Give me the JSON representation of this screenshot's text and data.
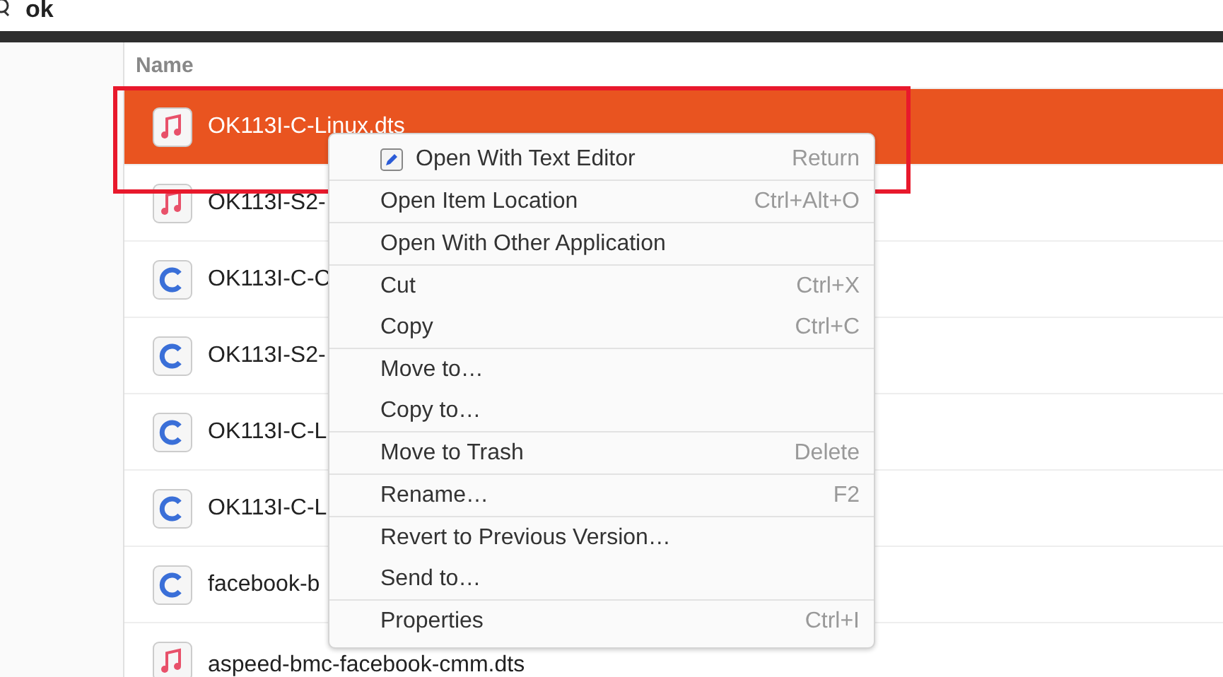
{
  "search": {
    "value": "ok"
  },
  "list": {
    "column_header": "Name",
    "rows": [
      {
        "name": "OK113I-C-Linux.dts",
        "kind": "music",
        "selected": true
      },
      {
        "name": "OK113I-S2-",
        "kind": "music",
        "selected": false
      },
      {
        "name": "OK113I-C-C",
        "kind": "c",
        "selected": false
      },
      {
        "name": "OK113I-S2-",
        "kind": "c",
        "selected": false
      },
      {
        "name": "OK113I-C-L",
        "kind": "c",
        "selected": false
      },
      {
        "name": "OK113I-C-L",
        "kind": "c",
        "selected": false
      },
      {
        "name": "facebook-b",
        "kind": "c",
        "selected": false
      },
      {
        "name": "aspeed-bmc-facebook-cmm.dts",
        "kind": "music",
        "selected": false
      }
    ]
  },
  "context_menu": {
    "groups": [
      [
        {
          "label": "Open With Text Editor",
          "shortcut": "Return",
          "kind": "editor"
        }
      ],
      [
        {
          "label": "Open Item Location",
          "shortcut": "Ctrl+Alt+O",
          "kind": "plain"
        }
      ],
      [
        {
          "label": "Open With Other Application",
          "kind": "plain"
        }
      ],
      [
        {
          "label": "Cut",
          "shortcut": "Ctrl+X",
          "kind": "plain"
        },
        {
          "label": "Copy",
          "shortcut": "Ctrl+C",
          "kind": "plain"
        }
      ],
      [
        {
          "label": "Move to…",
          "kind": "plain"
        },
        {
          "label": "Copy to…",
          "kind": "plain"
        }
      ],
      [
        {
          "label": "Move to Trash",
          "shortcut": "Delete",
          "kind": "plain"
        }
      ],
      [
        {
          "label": "Rename…",
          "shortcut": "F2",
          "kind": "plain"
        }
      ],
      [
        {
          "label": "Revert to Previous Version…",
          "kind": "plain"
        },
        {
          "label": "Send to…",
          "kind": "plain"
        }
      ],
      [
        {
          "label": "Properties",
          "shortcut": "Ctrl+I",
          "kind": "plain"
        }
      ]
    ]
  }
}
